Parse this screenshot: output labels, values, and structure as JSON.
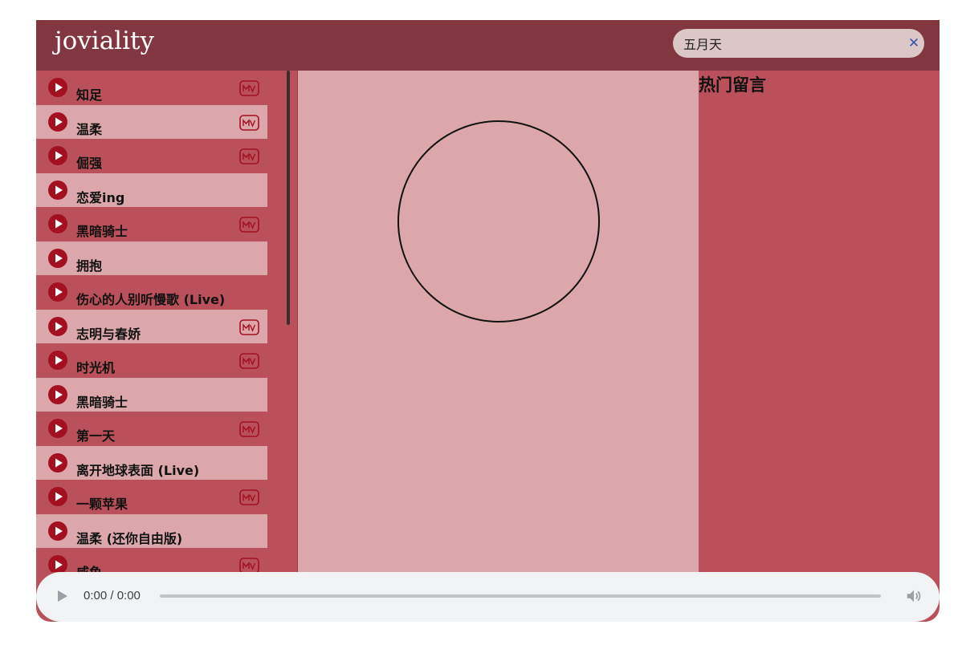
{
  "header": {
    "logo": "joviality"
  },
  "search": {
    "value": "五月天",
    "clear_icon": "close-icon"
  },
  "songs": [
    {
      "title": "知足",
      "mv": true
    },
    {
      "title": "温柔",
      "mv": true
    },
    {
      "title": "倔强",
      "mv": true
    },
    {
      "title": "恋爱ing",
      "mv": false
    },
    {
      "title": "黑暗骑士",
      "mv": true
    },
    {
      "title": "拥抱",
      "mv": false
    },
    {
      "title": "伤心的人别听慢歌 (Live)",
      "mv": false
    },
    {
      "title": "志明与春娇",
      "mv": true
    },
    {
      "title": "时光机",
      "mv": true
    },
    {
      "title": "黑暗骑士",
      "mv": false
    },
    {
      "title": "第一天",
      "mv": true
    },
    {
      "title": "离开地球表面 (Live)",
      "mv": false
    },
    {
      "title": "一颗苹果",
      "mv": true
    },
    {
      "title": "温柔 (还你自由版)",
      "mv": false
    },
    {
      "title": "咸鱼",
      "mv": true
    }
  ],
  "comments": {
    "title": "热门留言"
  },
  "audio": {
    "time": "0:00 / 0:00"
  },
  "colors": {
    "header": "#82363f",
    "primary": "#b9505a",
    "light": "#dca7ab",
    "accent_icon": "#a3101f"
  }
}
